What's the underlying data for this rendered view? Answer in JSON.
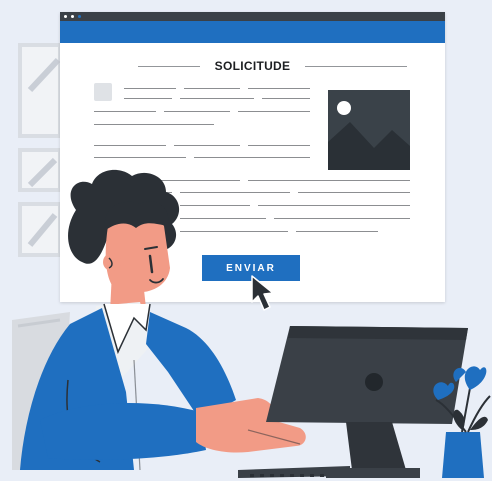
{
  "form": {
    "heading": "SOLICITUDE",
    "submit_label": "ENVIAR"
  },
  "icons": {
    "window_controls": "window-dots",
    "image": "image-placeholder-icon",
    "cursor": "mouse-pointer-icon"
  },
  "colors": {
    "accent": "#1f6fc0",
    "titlebar": "#3a4047",
    "background": "#e9eef7",
    "skin": "#f29b86",
    "hair": "#2b3036"
  }
}
